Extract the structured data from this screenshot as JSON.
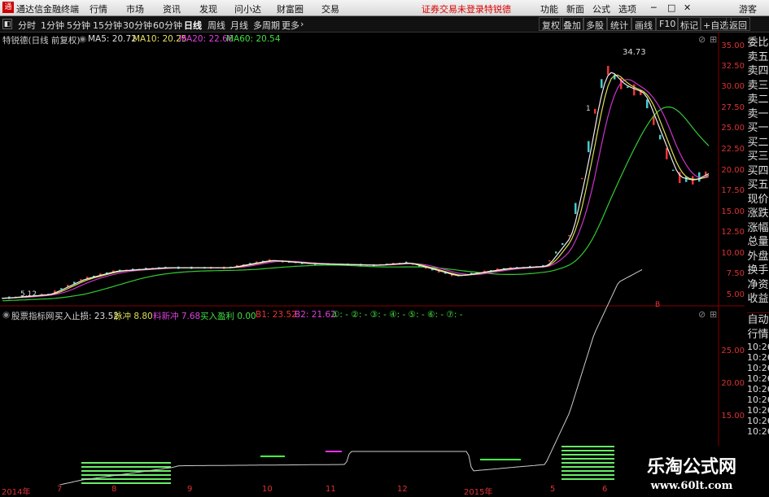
{
  "titlebar": {
    "app_name": "通达信金融终端",
    "menus": [
      "行情",
      "市场",
      "资讯",
      "发现",
      "问小达",
      "财富圈",
      "交易"
    ],
    "notice": "证券交易未登录",
    "stock_label": "特锐德",
    "right_menus": [
      "功能",
      "新面",
      "公式",
      "选项"
    ],
    "account": "游客"
  },
  "toolbar": {
    "periods": [
      "分时",
      "1分钟",
      "5分钟",
      "15分钟",
      "30分钟",
      "60分钟",
      "日线",
      "周线",
      "月线",
      "多周期",
      "更多"
    ],
    "active_period": "日线",
    "right_buttons": [
      "复权",
      "叠加",
      "多股",
      "统计",
      "画线",
      "F10",
      "标记",
      "+自选",
      "返回"
    ]
  },
  "main_legend": {
    "title": "特锐德(日线 前复权)",
    "ma5": "MA5: 20.72",
    "ma10": "MA10: 20.25",
    "ma20": "MA20: 22.66",
    "ma60": "MA60: 20.54"
  },
  "peak_label": "34.73",
  "low_label": "5.12",
  "ann_one": "1",
  "ann_b": "B",
  "indicator_legend": {
    "title": "股票指标网",
    "buy_stop": "买入止损: 23.52",
    "pulse": "脉冲 8.80",
    "tiaozhan": "料新冲 7.68",
    "buy_profit": "买入盈利 0.00",
    "b1": "B1: 23.52",
    "b2": "B2: 21.62",
    "extra": "①: - ②: - ③: - ④: - ⑤: - ⑥: - ⑦: -"
  },
  "y_axis_main": [
    "35.00",
    "32.50",
    "30.00",
    "27.50",
    "25.00",
    "22.50",
    "20.00",
    "17.50",
    "15.00",
    "12.50",
    "10.00",
    "7.50",
    "5.00"
  ],
  "y_axis_sub": [
    "25.00",
    "20.00",
    "15.00"
  ],
  "x_axis": [
    "2014年",
    "7",
    "8",
    "9",
    "10",
    "11",
    "12",
    "2015年",
    "5",
    "6"
  ],
  "side_panel": [
    "委比",
    "卖五",
    "卖四",
    "卖三",
    "卖二",
    "卖一",
    "买一",
    "买二",
    "买三",
    "买四",
    "买五",
    "现价",
    "涨跌",
    "涨幅",
    "总量",
    "外盘",
    "换手",
    "净资",
    "收益"
  ],
  "side_panel2": [
    "自动",
    "行情"
  ],
  "times": [
    "10:26",
    "10:26",
    "10:26",
    "10:26",
    "10:26",
    "10:26",
    "10:26",
    "10:26",
    "10:26"
  ],
  "watermark": {
    "line1": "乐淘公式网",
    "line2": "www.60lt.com"
  },
  "chart_data": {
    "type": "line",
    "title": "特锐德(日线 前复权)",
    "series": [
      {
        "name": "MA5",
        "values": []
      },
      {
        "name": "MA10",
        "values": []
      },
      {
        "name": "MA20",
        "values": []
      },
      {
        "name": "MA60",
        "values": []
      }
    ],
    "ylim": [
      5,
      35
    ]
  }
}
